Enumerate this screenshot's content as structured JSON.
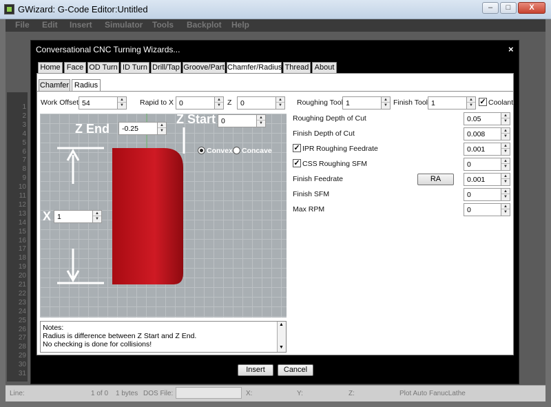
{
  "window": {
    "title": "GWizard: G-Code Editor:Untitled",
    "min_label": "–",
    "max_label": "□",
    "close_label": "X"
  },
  "menu": [
    "File",
    "Edit",
    "Insert",
    "Simulator",
    "Tools",
    "Backplot",
    "Help"
  ],
  "line_numbers": [
    "1",
    "2",
    "3",
    "4",
    "5",
    "6",
    "7",
    "8",
    "9",
    "10",
    "11",
    "12",
    "13",
    "14",
    "15",
    "16",
    "17",
    "18",
    "19",
    "20",
    "21",
    "22",
    "23",
    "24",
    "25",
    "26",
    "27",
    "28",
    "29",
    "30",
    "31"
  ],
  "status": {
    "line_label": "Line:",
    "position": "1 of 0",
    "bytes": "1 bytes",
    "dos_file_label": "DOS File:",
    "x_label": "X:",
    "y_label": "Y:",
    "z_label": "Z:",
    "plot_auto": "Plot Auto",
    "machine": "FanucLathe"
  },
  "dialog": {
    "title": "Conversational CNC Turning Wizards...",
    "close_label": "×",
    "tabs": [
      "Home",
      "Face",
      "OD Turn",
      "ID Turn",
      "Drill/Tap",
      "Groove/Part",
      "Chamfer/Radius",
      "Thread",
      "About"
    ],
    "active_tab": "Chamfer/Radius",
    "subtabs": [
      "Chamfer",
      "Radius"
    ],
    "active_subtab": "Radius",
    "work_offset": {
      "label": "Work Offset",
      "value": "54"
    },
    "rapid_x": {
      "label": "Rapid to X",
      "value": "0"
    },
    "rapid_z": {
      "label": "Z",
      "value": "0"
    },
    "roughing_tool": {
      "label": "Roughing Tool",
      "value": "1"
    },
    "finish_tool": {
      "label": "Finish Tool",
      "value": "1"
    },
    "coolant": {
      "label": "Coolant",
      "checked": true
    },
    "z_end": {
      "label": "Z End",
      "value": "-0.25"
    },
    "z_start": {
      "label": "Z Start",
      "value": "0"
    },
    "x": {
      "label": "X",
      "value": "1"
    },
    "convex": {
      "label": "Convex",
      "selected": true
    },
    "concave": {
      "label": "Concave",
      "selected": false
    },
    "params": [
      {
        "label": "Roughing Depth of Cut",
        "value": "0.05"
      },
      {
        "label": "Finish Depth of Cut",
        "value": "0.008"
      },
      {
        "label": "IPR",
        "sublabel": "Roughing Feedrate",
        "value": "0.001",
        "checked": true
      },
      {
        "label": "CSS",
        "sublabel": "Roughing SFM",
        "value": "0",
        "checked": true
      },
      {
        "label": "Finish Feedrate",
        "value": "0.001"
      },
      {
        "label": "Finish SFM",
        "value": "0"
      },
      {
        "label": "Max RPM",
        "value": "0"
      }
    ],
    "ra_button": "RA",
    "notes": [
      "Notes:",
      "Radius is difference between Z Start and Z End.",
      "No checking is done for collisions!"
    ],
    "insert_button": "Insert",
    "cancel_button": "Cancel",
    "checkmark": "✓",
    "spin_up": "▲",
    "spin_down": "▼"
  },
  "colors": {
    "part": "#c0111a",
    "grid": "#a9afb3",
    "dialog_frame": "#000000"
  }
}
